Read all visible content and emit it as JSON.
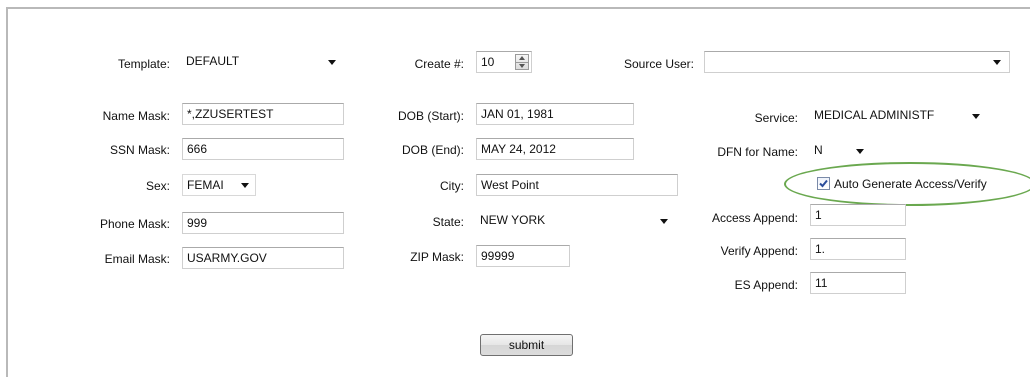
{
  "form": {
    "template": {
      "label": "Template:",
      "value": "DEFAULT"
    },
    "create_count": {
      "label": "Create #:",
      "value": "10"
    },
    "source_user": {
      "label": "Source User:",
      "value": ""
    },
    "name_mask": {
      "label": "Name Mask:",
      "value": "*,ZZUSERTEST"
    },
    "ssn_mask": {
      "label": "SSN Mask:",
      "value": "666"
    },
    "sex": {
      "label": "Sex:",
      "value": "FEMAI"
    },
    "phone_mask": {
      "label": "Phone Mask:",
      "value": "999"
    },
    "email_mask": {
      "label": "Email Mask:",
      "value": "USARMY.GOV"
    },
    "dob_start": {
      "label": "DOB (Start):",
      "value": "JAN 01, 1981"
    },
    "dob_end": {
      "label": "DOB (End):",
      "value": "MAY 24, 2012"
    },
    "city": {
      "label": "City:",
      "value": "West Point"
    },
    "state": {
      "label": "State:",
      "value": "NEW YORK"
    },
    "zip_mask": {
      "label": "ZIP Mask:",
      "value": "99999"
    },
    "service": {
      "label": "Service:",
      "value": "MEDICAL ADMINISTF"
    },
    "dfn_for_name": {
      "label": "DFN for Name:",
      "value": "N"
    },
    "auto_generate": {
      "label": "Auto Generate Access/Verify",
      "checked": true
    },
    "access_append": {
      "label": "Access Append:",
      "value": "1"
    },
    "verify_append": {
      "label": "Verify Append:",
      "value": "1."
    },
    "es_append": {
      "label": "ES Append:",
      "value": "11"
    },
    "submit_label": "submit"
  },
  "colors": {
    "highlight_ellipse": "#6aa84f",
    "checkbox_mark": "#2a4c9b"
  }
}
